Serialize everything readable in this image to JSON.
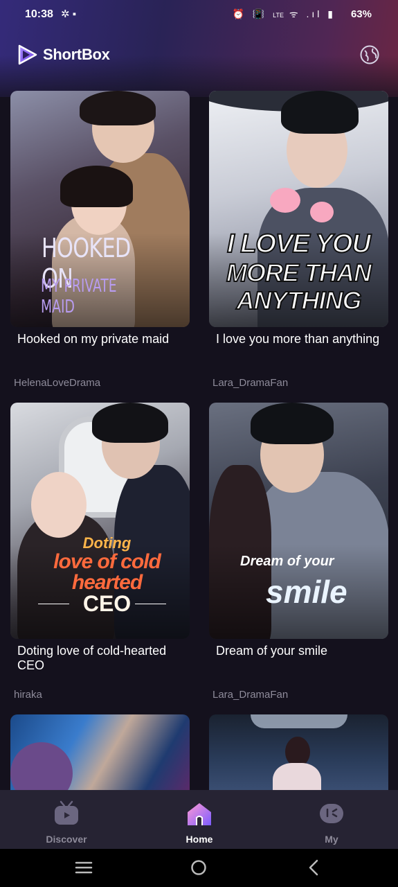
{
  "status_bar": {
    "time": "10:38",
    "battery": "63%",
    "network_label": "LTE"
  },
  "header": {
    "app_name": "ShortBox",
    "logo_icon": "play-triangle-icon",
    "globe_icon": "globe-icon"
  },
  "dramas": [
    {
      "title": "Hooked on my private maid",
      "author": "HelenaLoveDrama",
      "poster_line1": "HOOKED ON",
      "poster_line2": "MY PRIVATE MAID"
    },
    {
      "title": "I love you more than anything",
      "author": "Lara_DramaFan",
      "poster_line1": "I LOVE YOU",
      "poster_line2": "MORE THAN",
      "poster_line3": "ANYTHING"
    },
    {
      "title": "Doting love of cold-hearted CEO",
      "author": "hiraka",
      "poster_line1": "Doting",
      "poster_line2": "love of cold",
      "poster_line3": "hearted",
      "poster_line4": "CEO"
    },
    {
      "title": "Dream of your smile",
      "author": "Lara_DramaFan",
      "poster_line1": "Dream of your",
      "poster_line2": "smile"
    }
  ],
  "bottom_nav": {
    "items": [
      {
        "label": "Discover",
        "icon": "tv-play-icon",
        "active": false
      },
      {
        "label": "Home",
        "icon": "house-icon",
        "active": true
      },
      {
        "label": "My",
        "icon": "profile-chat-icon",
        "active": false
      }
    ]
  },
  "colors": {
    "accent": "#7c5cff",
    "background": "#14111d",
    "nav_inactive": "#8e8b9a"
  }
}
